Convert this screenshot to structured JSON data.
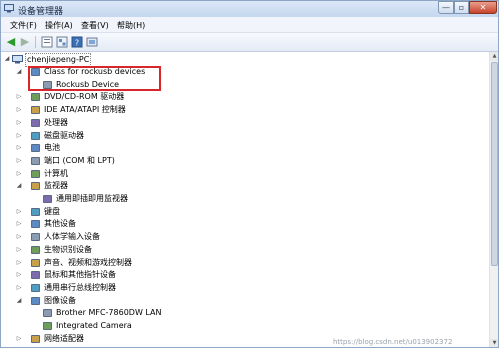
{
  "window": {
    "title": "设备管理器",
    "min_label": "—",
    "max_label": "▫",
    "close_label": "✕"
  },
  "menu": {
    "items": [
      "文件(F)",
      "操作(A)",
      "查看(V)",
      "帮助(H)"
    ]
  },
  "toolbar": {
    "icons": [
      "back-arrow-icon",
      "forward-arrow-icon",
      "properties-icon",
      "view-icon",
      "help-icon",
      "update-icon"
    ]
  },
  "tree": {
    "root": "chenjiepeng-PC",
    "rows": [
      {
        "label": "Class for rockusb devices",
        "expanded": true,
        "icon": "usb-class-icon"
      },
      {
        "label": "Rockusb Device",
        "child": true,
        "icon": "usb-device-icon"
      },
      {
        "label": "DVD/CD-ROM 驱动器",
        "icon": "dvd-drive-icon"
      },
      {
        "label": "IDE ATA/ATAPI 控制器",
        "icon": "ide-controller-icon"
      },
      {
        "label": "处理器",
        "icon": "processor-icon"
      },
      {
        "label": "磁盘驱动器",
        "icon": "disk-drive-icon"
      },
      {
        "label": "电池",
        "icon": "battery-icon"
      },
      {
        "label": "端口 (COM 和 LPT)",
        "icon": "port-icon"
      },
      {
        "label": "计算机",
        "icon": "computer-icon"
      },
      {
        "label": "监视器",
        "expanded": true,
        "icon": "monitor-icon"
      },
      {
        "label": "通用即插即用监视器",
        "child": true,
        "icon": "monitor-icon"
      },
      {
        "label": "键盘",
        "icon": "keyboard-icon"
      },
      {
        "label": "其他设备",
        "icon": "other-devices-icon"
      },
      {
        "label": "人体学输入设备",
        "icon": "hid-icon"
      },
      {
        "label": "生物识别设备",
        "icon": "biometric-icon"
      },
      {
        "label": "声音、视频和游戏控制器",
        "icon": "sound-icon"
      },
      {
        "label": "鼠标和其他指针设备",
        "icon": "mouse-icon"
      },
      {
        "label": "通用串行总线控制器",
        "icon": "usb-controller-icon"
      },
      {
        "label": "图像设备",
        "expanded": true,
        "icon": "imaging-icon"
      },
      {
        "label": "Brother MFC-7860DW LAN",
        "child": true,
        "icon": "scanner-icon"
      },
      {
        "label": "Integrated Camera",
        "child": true,
        "icon": "camera-icon"
      },
      {
        "label": "网络适配器",
        "icon": "network-adapter-icon"
      }
    ]
  },
  "watermark": "https://blog.csdn.net/u013902372",
  "colors": {
    "highlight": "#d9262a",
    "title_bar": "#dbe8f7",
    "tree_line": "#555555"
  }
}
